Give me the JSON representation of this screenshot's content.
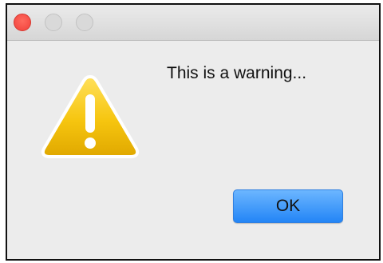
{
  "titlebar": {
    "controls": {
      "close": {
        "icon": "close-dot-icon",
        "color": "#f4463f"
      },
      "minimize": {
        "icon": "minimize-dot-icon",
        "color": "#d9d9d9"
      },
      "zoom": {
        "icon": "zoom-dot-icon",
        "color": "#d9d9d9"
      }
    }
  },
  "dialog": {
    "icon": "warning-icon",
    "message": "This is a warning...",
    "ok_label": "OK"
  },
  "colors": {
    "warning_yellow": "#f4c20d",
    "button_blue": "#2f8cf7"
  }
}
